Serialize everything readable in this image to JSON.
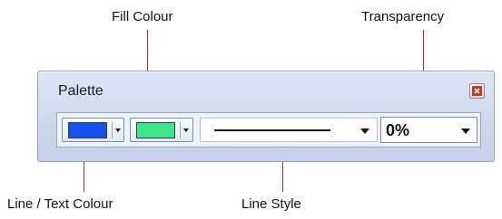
{
  "callouts": {
    "fill_colour": "Fill Colour",
    "transparency": "Transparency",
    "line_text_colour": "Line / Text Colour",
    "line_style": "Line Style"
  },
  "palette": {
    "title": "Palette",
    "close_icon": "close-icon",
    "line_text_colour": {
      "swatch_color": "#1452f0",
      "icon": "chevron-down-icon"
    },
    "fill_colour": {
      "swatch_color": "#3ee88a",
      "icon": "chevron-down-icon"
    },
    "line_style": {
      "selected": "solid",
      "icon": "chevron-down-icon"
    },
    "transparency": {
      "value": "0%",
      "icon": "chevron-down-icon"
    }
  },
  "colors": {
    "callout_line": "#e01b1b",
    "panel_border": "#8ea3c6"
  }
}
